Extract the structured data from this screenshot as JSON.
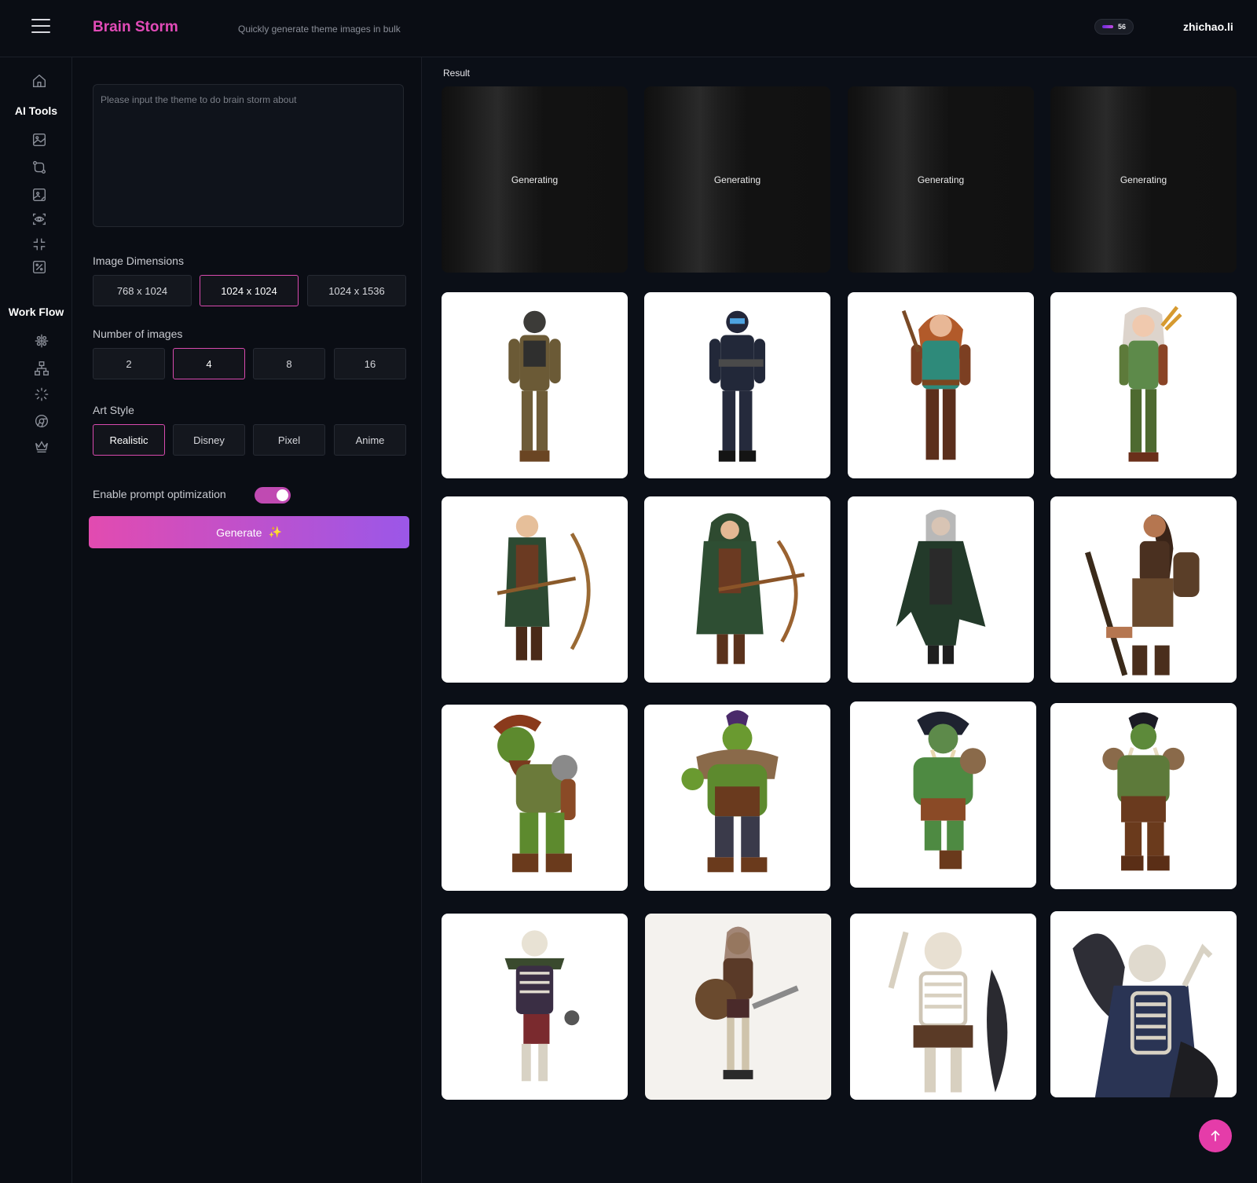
{
  "header": {
    "brand": "Brain Storm",
    "tagline": "Quickly generate theme images in bulk",
    "credits": "56",
    "user": "zhichao.li"
  },
  "nav": {
    "ai_tools_heading": "AI Tools",
    "workflow_heading": "Work Flow",
    "icons": [
      "home-icon",
      "image-icon",
      "transfer-icon",
      "image-edit-icon",
      "scan-eye-icon",
      "shrink-icon",
      "image-percent-icon",
      "grid-icon",
      "network-icon",
      "loader-icon",
      "chrome-icon",
      "crown-icon"
    ]
  },
  "form": {
    "theme_placeholder": "Please input the theme to do brain storm about",
    "dimensions_label": "Image Dimensions",
    "dimensions": [
      "768  x  1024",
      "1024  x  1024",
      "1024  x  1536"
    ],
    "dimensions_selected": "1024  x  1024",
    "count_label": "Number of images",
    "counts": [
      "2",
      "4",
      "8",
      "16"
    ],
    "count_selected": "4",
    "style_label": "Art Style",
    "styles": [
      "Realistic",
      "Disney",
      "Pixel",
      "Anime"
    ],
    "style_selected": "Realistic",
    "optimization_label": "Enable prompt optimization",
    "optimization_enabled": true,
    "generate_label": "Generate"
  },
  "result": {
    "label": "Result",
    "generating_label": "Generating",
    "generating_count": 4,
    "images": [
      "soldier-olive-gear",
      "soldier-navy-armor",
      "redhead-ranger-teal",
      "elf-archer-green",
      "elf-archer-bow-green",
      "elf-archer-hooded",
      "elf-rogue-dark-cloak",
      "elf-warrior-tan",
      "orc-red-hair",
      "orc-purple-hair",
      "orc-black-hair",
      "orc-tusk-armor",
      "skeleton-warrior-purple",
      "skeleton-shield-sword",
      "skeleton-shield-dark",
      "skeleton-axe"
    ]
  },
  "colors": {
    "accent": "#e24bb8",
    "gradient_end": "#9b57e8",
    "bg": "#0b0f17"
  }
}
